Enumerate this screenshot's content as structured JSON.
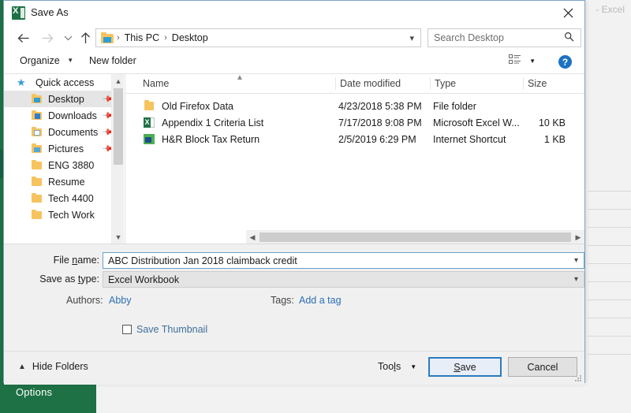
{
  "window": {
    "title": "Save As",
    "app_icon": "excel-icon",
    "close_icon": "close-icon",
    "excel_title_remnant": "- Excel",
    "backstage_options_label": "Options"
  },
  "nav": {
    "back_icon": "arrow-left-icon",
    "forward_icon": "arrow-right-icon",
    "recent_icon": "chevron-down-icon",
    "up_icon": "arrow-up-icon",
    "refresh_icon": "refresh-icon",
    "breadcrumb": [
      "This PC",
      "Desktop"
    ],
    "breadcrumb_separator": "›",
    "address_caret_icon": "chevron-down-icon",
    "search_placeholder": "Search Desktop",
    "search_icon": "search-icon"
  },
  "commandbar": {
    "organize_label": "Organize",
    "organize_caret": "▼",
    "new_folder_label": "New folder",
    "view_icon": "view-list-icon",
    "view_caret": "▼",
    "help_icon": "help-icon",
    "help_label": "?"
  },
  "navpane": {
    "scroll_up_icon": "chevron-up-icon",
    "scroll_down_icon": "chevron-down-icon",
    "items": [
      {
        "label": "Quick access",
        "icon": "star-icon",
        "pinned": false,
        "selected": false,
        "indent": false
      },
      {
        "label": "Desktop",
        "icon": "folder-desktop-icon",
        "pinned": true,
        "selected": true,
        "indent": true
      },
      {
        "label": "Downloads",
        "icon": "folder-downloads-icon",
        "pinned": true,
        "selected": false,
        "indent": true
      },
      {
        "label": "Documents",
        "icon": "folder-documents-icon",
        "pinned": true,
        "selected": false,
        "indent": true
      },
      {
        "label": "Pictures",
        "icon": "folder-pictures-icon",
        "pinned": true,
        "selected": false,
        "indent": true
      },
      {
        "label": "ENG 3880",
        "icon": "folder-icon",
        "pinned": false,
        "selected": false,
        "indent": true
      },
      {
        "label": "Resume",
        "icon": "folder-icon",
        "pinned": false,
        "selected": false,
        "indent": true
      },
      {
        "label": "Tech 4400",
        "icon": "folder-icon",
        "pinned": false,
        "selected": false,
        "indent": true
      },
      {
        "label": "Tech Work",
        "icon": "folder-icon",
        "pinned": false,
        "selected": false,
        "indent": true
      }
    ]
  },
  "filelist": {
    "columns": {
      "name": "Name",
      "date_modified": "Date modified",
      "type": "Type",
      "size": "Size"
    },
    "sort_indicator_icon": "chevron-up-icon",
    "rows": [
      {
        "name": "Old Firefox Data",
        "icon": "folder-icon",
        "date_modified": "4/23/2018 5:38 PM",
        "type": "File folder",
        "size": ""
      },
      {
        "name": "Appendix 1 Criteria List",
        "icon": "excel-file-icon",
        "date_modified": "7/17/2018 9:08 PM",
        "type": "Microsoft Excel W...",
        "size": "10 KB"
      },
      {
        "name": "H&R Block Tax Return",
        "icon": "internet-shortcut-icon",
        "date_modified": "2/5/2019 6:29 PM",
        "type": "Internet Shortcut",
        "size": "1 KB"
      }
    ],
    "hscroll_left_icon": "chevron-left-icon",
    "hscroll_right_icon": "chevron-right-icon"
  },
  "form": {
    "file_name_label_pre": "File ",
    "file_name_label_accel": "n",
    "file_name_label_post": "ame:",
    "file_name_value": "ABC Distribution Jan 2018 claimback credit",
    "save_as_type_label_pre": "Save as ",
    "save_as_type_label_accel": "t",
    "save_as_type_label_post": "ype:",
    "save_as_type_value": "Excel Workbook",
    "dropdown_icon": "chevron-down-icon",
    "authors_label": "Authors:",
    "authors_value": "Abby",
    "tags_label": "Tags:",
    "tags_value": "Add a tag",
    "save_thumbnail_label": "Save Thumbnail",
    "save_thumbnail_checked": false
  },
  "footer": {
    "hide_folders_label": "Hide Folders",
    "hide_folders_icon": "chevron-up-icon",
    "tools_label_pre": "Too",
    "tools_label_accel": "l",
    "tools_label_post": "s",
    "tools_caret": "▼",
    "save_label_pre": "",
    "save_label_accel": "S",
    "save_label_post": "ave",
    "cancel_label": "Cancel",
    "resize_grip_icon": "resize-grip-icon"
  },
  "colors": {
    "excel_green": "#217346",
    "accent_blue": "#2a7bc0",
    "link_blue": "#2b6fb5",
    "selection_gray": "#e5e5e5"
  }
}
